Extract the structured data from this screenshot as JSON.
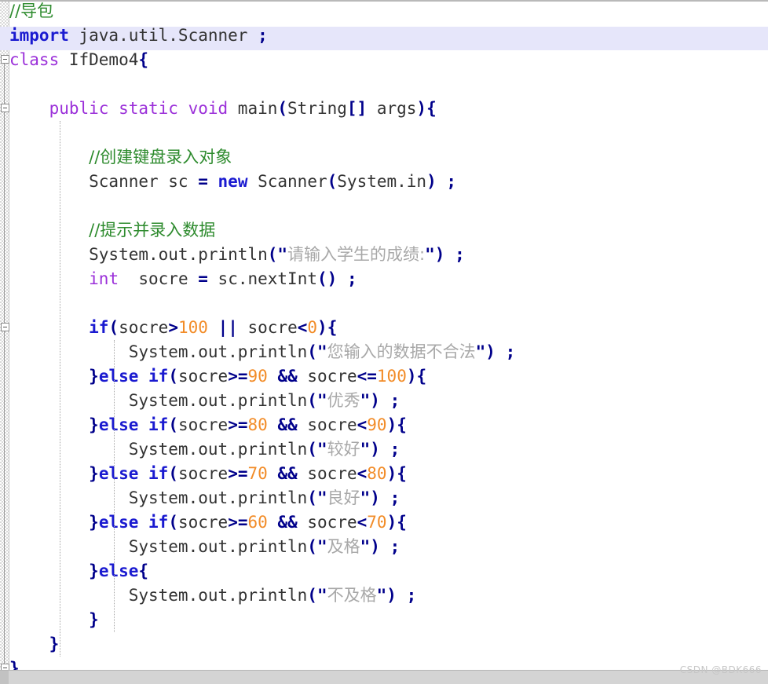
{
  "editor": {
    "language": "java",
    "file_name": "IfDemo4",
    "font_size_px": 21,
    "line_height_px": 31,
    "colors": {
      "background": "#ffffff",
      "comment": "#2e8b2e",
      "keyword": "#1a1ad0",
      "modifier": "#9b30d9",
      "punctuation": "#00008b",
      "number": "#f28c28",
      "string": "#a8a8a8",
      "plain": "#333333",
      "current_line_highlight": "#e6e6fa",
      "gutter": "#d8d8d8",
      "indent_guide": "#a9a9a9",
      "bottom_strip": "#d4d4d4",
      "watermark": "#c6c6c6"
    },
    "current_line_number": 2
  },
  "gutter": {
    "fold_markers": [
      {
        "line": 3,
        "state": "expanded",
        "symbol": "-"
      },
      {
        "line": 5,
        "state": "expanded",
        "symbol": "-"
      },
      {
        "line": 14,
        "state": "expanded",
        "symbol": "-"
      },
      {
        "line": 28,
        "state": "expanded",
        "symbol": "-"
      }
    ]
  },
  "code": {
    "lines": [
      {
        "number": 1,
        "tokens": [
          {
            "text": "//导包",
            "type": "comment"
          }
        ]
      },
      {
        "number": 2,
        "highlighted": true,
        "tokens": [
          {
            "text": "import",
            "type": "keyword"
          },
          {
            "text": " java.util.Scanner ",
            "type": "plain"
          },
          {
            "text": ";",
            "type": "punct"
          }
        ]
      },
      {
        "number": 3,
        "tokens": [
          {
            "text": "class",
            "type": "modifier"
          },
          {
            "text": " IfDemo4",
            "type": "plain"
          },
          {
            "text": "{",
            "type": "punct"
          }
        ]
      },
      {
        "number": 4,
        "tokens": []
      },
      {
        "number": 5,
        "tokens": [
          {
            "text": "    ",
            "type": "plain"
          },
          {
            "text": "public static void",
            "type": "modifier"
          },
          {
            "text": " main",
            "type": "plain"
          },
          {
            "text": "(",
            "type": "punct"
          },
          {
            "text": "String",
            "type": "plain"
          },
          {
            "text": "[]",
            "type": "punct"
          },
          {
            "text": " args",
            "type": "plain"
          },
          {
            "text": ")",
            "type": "punct"
          },
          {
            "text": "{",
            "type": "punct"
          }
        ]
      },
      {
        "number": 6,
        "tokens": []
      },
      {
        "number": 7,
        "tokens": [
          {
            "text": "        ",
            "type": "plain"
          },
          {
            "text": "//创建键盘录入对象",
            "type": "comment"
          }
        ]
      },
      {
        "number": 8,
        "tokens": [
          {
            "text": "        Scanner sc ",
            "type": "plain"
          },
          {
            "text": "=",
            "type": "operator"
          },
          {
            "text": " ",
            "type": "plain"
          },
          {
            "text": "new",
            "type": "keyword"
          },
          {
            "text": " Scanner",
            "type": "plain"
          },
          {
            "text": "(",
            "type": "punct"
          },
          {
            "text": "System.in",
            "type": "plain"
          },
          {
            "text": ")",
            "type": "punct"
          },
          {
            "text": " ",
            "type": "plain"
          },
          {
            "text": ";",
            "type": "punct"
          }
        ]
      },
      {
        "number": 9,
        "tokens": []
      },
      {
        "number": 10,
        "tokens": [
          {
            "text": "        ",
            "type": "plain"
          },
          {
            "text": "//提示并录入数据",
            "type": "comment"
          }
        ]
      },
      {
        "number": 11,
        "tokens": [
          {
            "text": "        System.out.println",
            "type": "plain"
          },
          {
            "text": "(",
            "type": "punct"
          },
          {
            "text": "\"",
            "type": "quote"
          },
          {
            "text": "请输入学生的成绩:",
            "type": "string"
          },
          {
            "text": "\"",
            "type": "quote"
          },
          {
            "text": ")",
            "type": "punct"
          },
          {
            "text": " ",
            "type": "plain"
          },
          {
            "text": ";",
            "type": "punct"
          }
        ]
      },
      {
        "number": 12,
        "tokens": [
          {
            "text": "        ",
            "type": "plain"
          },
          {
            "text": "int",
            "type": "type"
          },
          {
            "text": "  socre ",
            "type": "plain"
          },
          {
            "text": "=",
            "type": "operator"
          },
          {
            "text": " sc.nextInt",
            "type": "plain"
          },
          {
            "text": "()",
            "type": "punct"
          },
          {
            "text": " ",
            "type": "plain"
          },
          {
            "text": ";",
            "type": "punct"
          }
        ]
      },
      {
        "number": 13,
        "tokens": []
      },
      {
        "number": 14,
        "tokens": [
          {
            "text": "        ",
            "type": "plain"
          },
          {
            "text": "if",
            "type": "keyword"
          },
          {
            "text": "(",
            "type": "punct"
          },
          {
            "text": "socre",
            "type": "plain"
          },
          {
            "text": ">",
            "type": "operator"
          },
          {
            "text": "100",
            "type": "number"
          },
          {
            "text": " ",
            "type": "plain"
          },
          {
            "text": "||",
            "type": "operator"
          },
          {
            "text": " socre",
            "type": "plain"
          },
          {
            "text": "<",
            "type": "operator"
          },
          {
            "text": "0",
            "type": "number"
          },
          {
            "text": ")",
            "type": "punct"
          },
          {
            "text": "{",
            "type": "punct"
          }
        ]
      },
      {
        "number": 15,
        "tokens": [
          {
            "text": "            System.out.println",
            "type": "plain"
          },
          {
            "text": "(",
            "type": "punct"
          },
          {
            "text": "\"",
            "type": "quote"
          },
          {
            "text": "您输入的数据不合法",
            "type": "string"
          },
          {
            "text": "\"",
            "type": "quote"
          },
          {
            "text": ")",
            "type": "punct"
          },
          {
            "text": " ",
            "type": "plain"
          },
          {
            "text": ";",
            "type": "punct"
          }
        ]
      },
      {
        "number": 16,
        "tokens": [
          {
            "text": "        ",
            "type": "plain"
          },
          {
            "text": "}",
            "type": "punct"
          },
          {
            "text": "else if",
            "type": "keyword"
          },
          {
            "text": "(",
            "type": "punct"
          },
          {
            "text": "socre",
            "type": "plain"
          },
          {
            "text": ">=",
            "type": "operator"
          },
          {
            "text": "90",
            "type": "number"
          },
          {
            "text": " ",
            "type": "plain"
          },
          {
            "text": "&&",
            "type": "operator"
          },
          {
            "text": " socre",
            "type": "plain"
          },
          {
            "text": "<=",
            "type": "operator"
          },
          {
            "text": "100",
            "type": "number"
          },
          {
            "text": ")",
            "type": "punct"
          },
          {
            "text": "{",
            "type": "punct"
          }
        ]
      },
      {
        "number": 17,
        "tokens": [
          {
            "text": "            System.out.println",
            "type": "plain"
          },
          {
            "text": "(",
            "type": "punct"
          },
          {
            "text": "\"",
            "type": "quote"
          },
          {
            "text": "优秀",
            "type": "string"
          },
          {
            "text": "\"",
            "type": "quote"
          },
          {
            "text": ")",
            "type": "punct"
          },
          {
            "text": " ",
            "type": "plain"
          },
          {
            "text": ";",
            "type": "punct"
          }
        ]
      },
      {
        "number": 18,
        "tokens": [
          {
            "text": "        ",
            "type": "plain"
          },
          {
            "text": "}",
            "type": "punct"
          },
          {
            "text": "else if",
            "type": "keyword"
          },
          {
            "text": "(",
            "type": "punct"
          },
          {
            "text": "socre",
            "type": "plain"
          },
          {
            "text": ">=",
            "type": "operator"
          },
          {
            "text": "80",
            "type": "number"
          },
          {
            "text": " ",
            "type": "plain"
          },
          {
            "text": "&&",
            "type": "operator"
          },
          {
            "text": " socre",
            "type": "plain"
          },
          {
            "text": "<",
            "type": "operator"
          },
          {
            "text": "90",
            "type": "number"
          },
          {
            "text": ")",
            "type": "punct"
          },
          {
            "text": "{",
            "type": "punct"
          }
        ]
      },
      {
        "number": 19,
        "tokens": [
          {
            "text": "            System.out.println",
            "type": "plain"
          },
          {
            "text": "(",
            "type": "punct"
          },
          {
            "text": "\"",
            "type": "quote"
          },
          {
            "text": "较好",
            "type": "string"
          },
          {
            "text": "\"",
            "type": "quote"
          },
          {
            "text": ")",
            "type": "punct"
          },
          {
            "text": " ",
            "type": "plain"
          },
          {
            "text": ";",
            "type": "punct"
          }
        ]
      },
      {
        "number": 20,
        "tokens": [
          {
            "text": "        ",
            "type": "plain"
          },
          {
            "text": "}",
            "type": "punct"
          },
          {
            "text": "else if",
            "type": "keyword"
          },
          {
            "text": "(",
            "type": "punct"
          },
          {
            "text": "socre",
            "type": "plain"
          },
          {
            "text": ">=",
            "type": "operator"
          },
          {
            "text": "70",
            "type": "number"
          },
          {
            "text": " ",
            "type": "plain"
          },
          {
            "text": "&&",
            "type": "operator"
          },
          {
            "text": " socre",
            "type": "plain"
          },
          {
            "text": "<",
            "type": "operator"
          },
          {
            "text": "80",
            "type": "number"
          },
          {
            "text": ")",
            "type": "punct"
          },
          {
            "text": "{",
            "type": "punct"
          }
        ]
      },
      {
        "number": 21,
        "tokens": [
          {
            "text": "            System.out.println",
            "type": "plain"
          },
          {
            "text": "(",
            "type": "punct"
          },
          {
            "text": "\"",
            "type": "quote"
          },
          {
            "text": "良好",
            "type": "string"
          },
          {
            "text": "\"",
            "type": "quote"
          },
          {
            "text": ")",
            "type": "punct"
          },
          {
            "text": " ",
            "type": "plain"
          },
          {
            "text": ";",
            "type": "punct"
          }
        ]
      },
      {
        "number": 22,
        "tokens": [
          {
            "text": "        ",
            "type": "plain"
          },
          {
            "text": "}",
            "type": "punct"
          },
          {
            "text": "else if",
            "type": "keyword"
          },
          {
            "text": "(",
            "type": "punct"
          },
          {
            "text": "socre",
            "type": "plain"
          },
          {
            "text": ">=",
            "type": "operator"
          },
          {
            "text": "60",
            "type": "number"
          },
          {
            "text": " ",
            "type": "plain"
          },
          {
            "text": "&&",
            "type": "operator"
          },
          {
            "text": " socre",
            "type": "plain"
          },
          {
            "text": "<",
            "type": "operator"
          },
          {
            "text": "70",
            "type": "number"
          },
          {
            "text": ")",
            "type": "punct"
          },
          {
            "text": "{",
            "type": "punct"
          }
        ]
      },
      {
        "number": 23,
        "tokens": [
          {
            "text": "            System.out.println",
            "type": "plain"
          },
          {
            "text": "(",
            "type": "punct"
          },
          {
            "text": "\"",
            "type": "quote"
          },
          {
            "text": "及格",
            "type": "string"
          },
          {
            "text": "\"",
            "type": "quote"
          },
          {
            "text": ")",
            "type": "punct"
          },
          {
            "text": " ",
            "type": "plain"
          },
          {
            "text": ";",
            "type": "punct"
          }
        ]
      },
      {
        "number": 24,
        "tokens": [
          {
            "text": "        ",
            "type": "plain"
          },
          {
            "text": "}",
            "type": "punct"
          },
          {
            "text": "else",
            "type": "keyword"
          },
          {
            "text": "{",
            "type": "punct"
          }
        ]
      },
      {
        "number": 25,
        "tokens": [
          {
            "text": "            System.out.println",
            "type": "plain"
          },
          {
            "text": "(",
            "type": "punct"
          },
          {
            "text": "\"",
            "type": "quote"
          },
          {
            "text": "不及格",
            "type": "string"
          },
          {
            "text": "\"",
            "type": "quote"
          },
          {
            "text": ")",
            "type": "punct"
          },
          {
            "text": " ",
            "type": "plain"
          },
          {
            "text": ";",
            "type": "punct"
          }
        ]
      },
      {
        "number": 26,
        "tokens": [
          {
            "text": "        ",
            "type": "plain"
          },
          {
            "text": "}",
            "type": "punct"
          }
        ]
      },
      {
        "number": 27,
        "tokens": [
          {
            "text": "    ",
            "type": "plain"
          },
          {
            "text": "}",
            "type": "punct"
          }
        ]
      },
      {
        "number": 28,
        "tokens": [
          {
            "text": "}",
            "type": "punct"
          }
        ]
      }
    ]
  },
  "watermark": {
    "text": "CSDN @BDK666"
  }
}
